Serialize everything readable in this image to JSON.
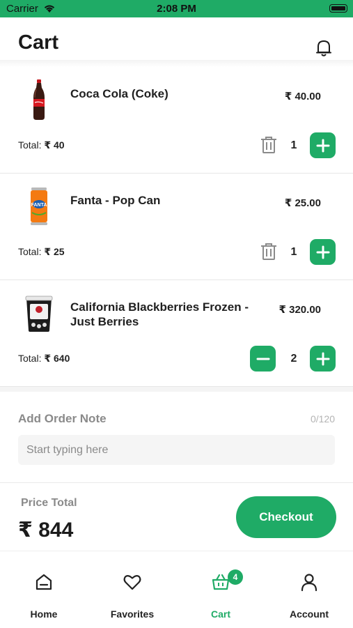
{
  "status_bar": {
    "carrier": "Carrier",
    "time": "2:08 PM"
  },
  "header": {
    "title": "Cart"
  },
  "cart": {
    "items": [
      {
        "name": "Coca Cola (Coke)",
        "price": "₹ 40.00",
        "total_label": "Total:",
        "total_value": "₹ 40",
        "qty": "1"
      },
      {
        "name": "Fanta - Pop Can",
        "price": "₹ 25.00",
        "total_label": "Total:",
        "total_value": "₹ 25",
        "qty": "1"
      },
      {
        "name": "California Blackberries Frozen - Just Berries",
        "price": "₹ 320.00",
        "total_label": "Total:",
        "total_value": "₹ 640",
        "qty": "2"
      }
    ]
  },
  "order_note": {
    "label": "Add Order Note",
    "counter": "0/120",
    "placeholder": "Start typing here"
  },
  "summary": {
    "label": "Price Total",
    "amount": "₹ 844",
    "checkout_label": "Checkout"
  },
  "tabs": [
    {
      "label": "Home",
      "icon": "home-icon"
    },
    {
      "label": "Favorites",
      "icon": "heart-icon"
    },
    {
      "label": "Cart",
      "icon": "basket-icon",
      "badge": "4"
    },
    {
      "label": "Account",
      "icon": "user-icon"
    }
  ],
  "colors": {
    "accent": "#1fab66",
    "status_bar": "#1fab66"
  }
}
